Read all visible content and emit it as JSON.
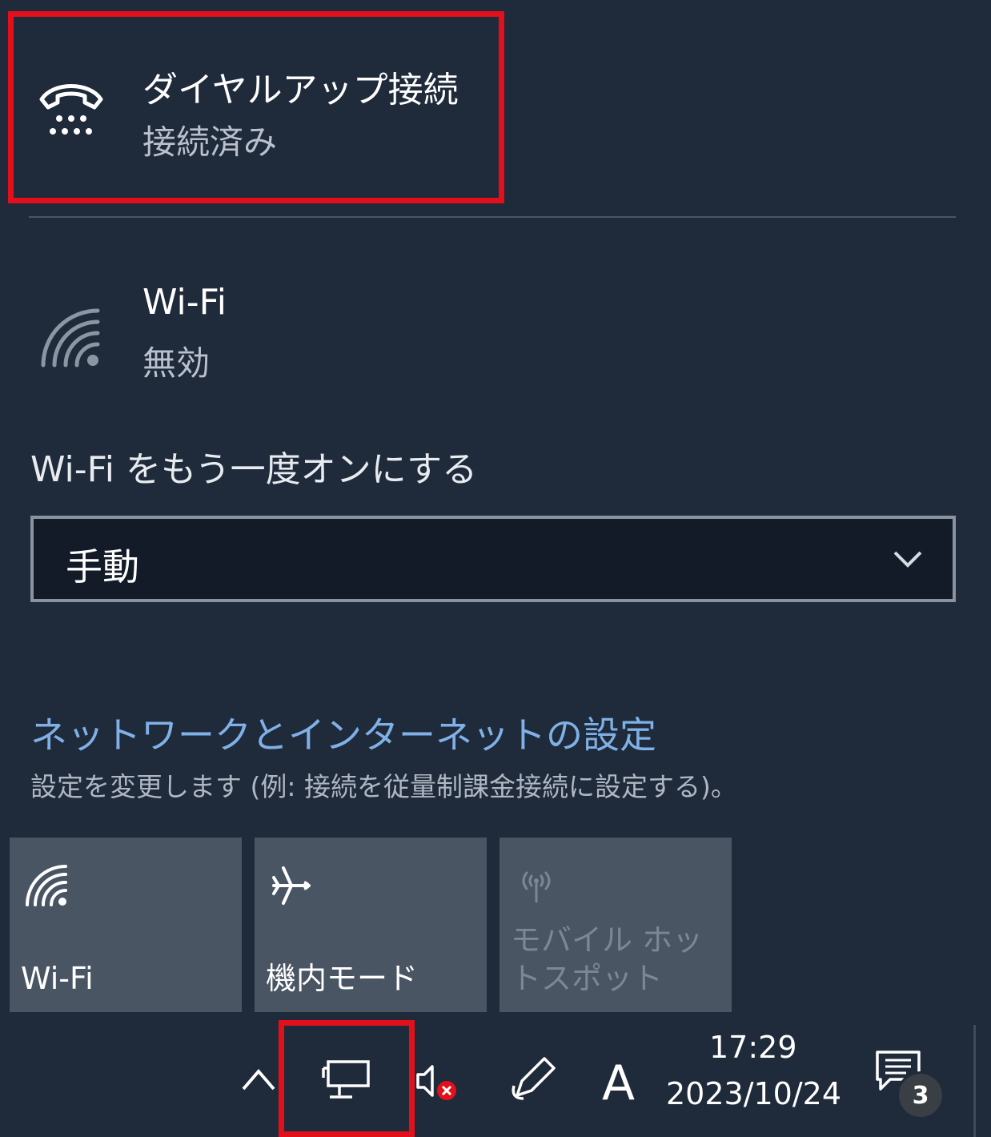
{
  "connections": [
    {
      "name": "ダイヤルアップ接続",
      "status": "接続済み",
      "icon": "dialup-phone-icon"
    },
    {
      "name": "Wi-Fi",
      "status": "無効",
      "icon": "wifi-icon"
    }
  ],
  "wifi_retry": {
    "label": "Wi-Fi をもう一度オンにする",
    "selected": "手動"
  },
  "settings": {
    "link": "ネットワークとインターネットの設定",
    "description": "設定を変更します (例: 接続を従量制課金接続に設定する)。"
  },
  "quick_actions": [
    {
      "label": "Wi-Fi",
      "icon": "wifi-icon",
      "enabled": true
    },
    {
      "label": "機内モード",
      "icon": "airplane-icon",
      "enabled": true
    },
    {
      "label": "モバイル ホットスポット",
      "icon": "hotspot-icon",
      "enabled": false
    }
  ],
  "taskbar": {
    "time": "17:29",
    "date": "2023/10/24",
    "ime": "A",
    "notification_count": "3"
  },
  "colors": {
    "background": "#1f2a3a",
    "highlight": "#e3101b",
    "link": "#7fb0e6",
    "tile": "#4a5564"
  }
}
